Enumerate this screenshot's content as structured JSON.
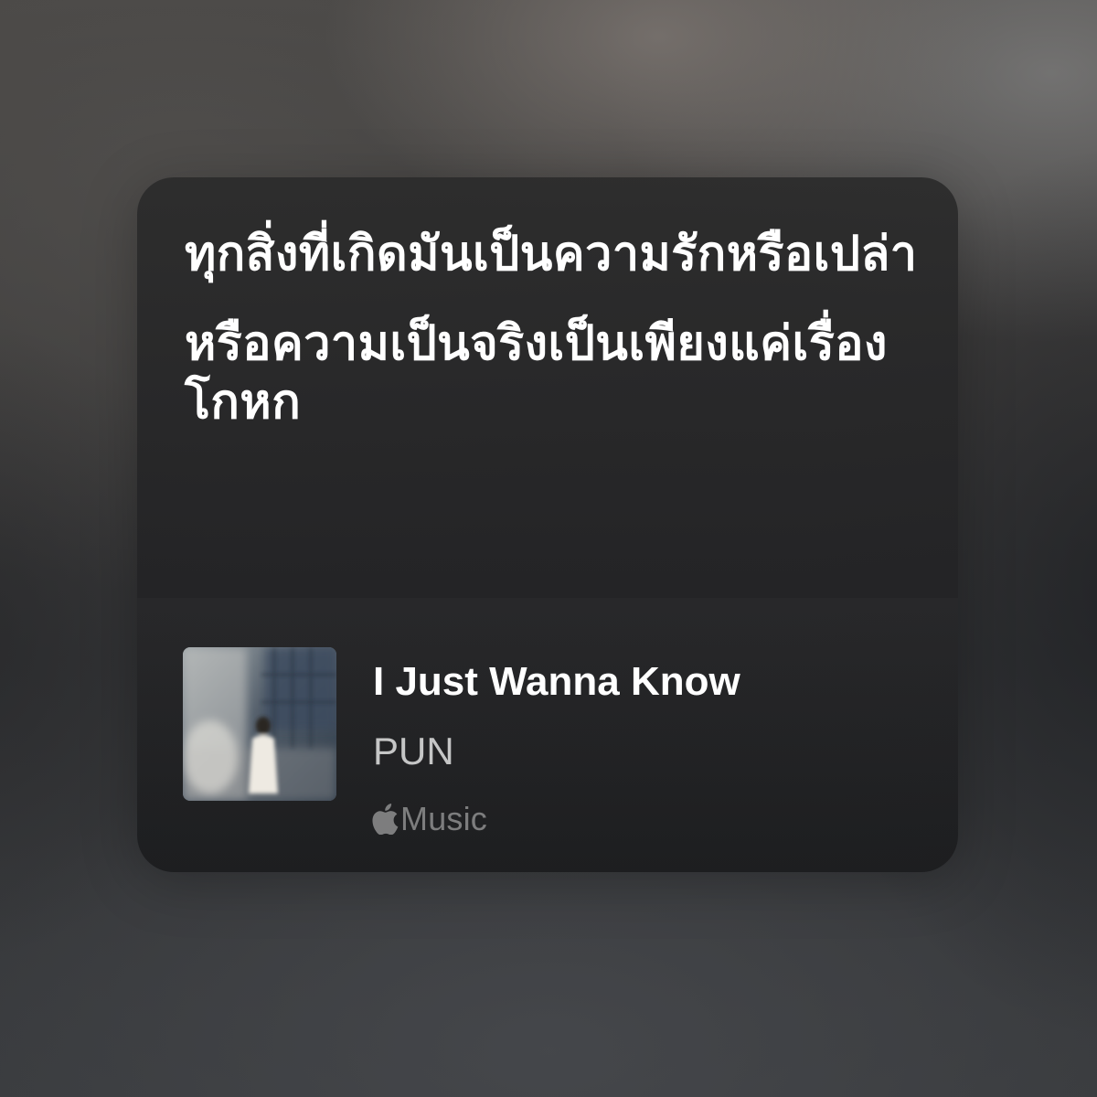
{
  "lyrics": [
    "ทุกสิ่งที่เกิดมันเป็นความรักหรือเปล่า",
    "หรือความเป็นจริงเป็นเพียงแค่เรื่องโกหก"
  ],
  "track": {
    "title": "I Just Wanna Know",
    "artist": "PUN",
    "artwork": "album-artwork"
  },
  "service": {
    "icon": "apple-logo-icon",
    "label": "Music"
  },
  "colors": {
    "card_background": "#2a2a2b",
    "lyric_text": "#ffffff",
    "artist_text": "#bcbcbc",
    "service_text": "#7a7a7a"
  }
}
